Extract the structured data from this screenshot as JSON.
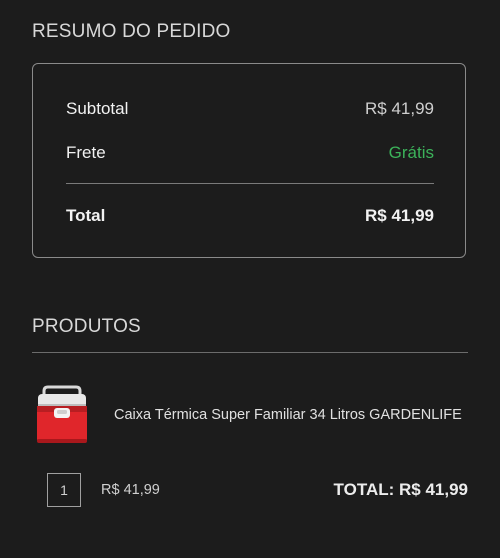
{
  "summary": {
    "title": "RESUMO DO PEDIDO",
    "subtotal_label": "Subtotal",
    "subtotal_value": "R$ 41,99",
    "shipping_label": "Frete",
    "shipping_value": "Grátis",
    "total_label": "Total",
    "total_value": "R$ 41,99"
  },
  "products": {
    "title": "PRODUTOS",
    "items": [
      {
        "name": "Caixa Térmica Super Familiar 34 Litros GARDENLIFE",
        "quantity": "1",
        "unit_price": "R$ 41,99",
        "line_total": "TOTAL: R$ 41,99",
        "thumbnail_icon": "red-cooler-box"
      }
    ]
  },
  "colors": {
    "background": "#1c1c1c",
    "free_shipping": "#3cb25a",
    "text": "#e6e6e6"
  }
}
